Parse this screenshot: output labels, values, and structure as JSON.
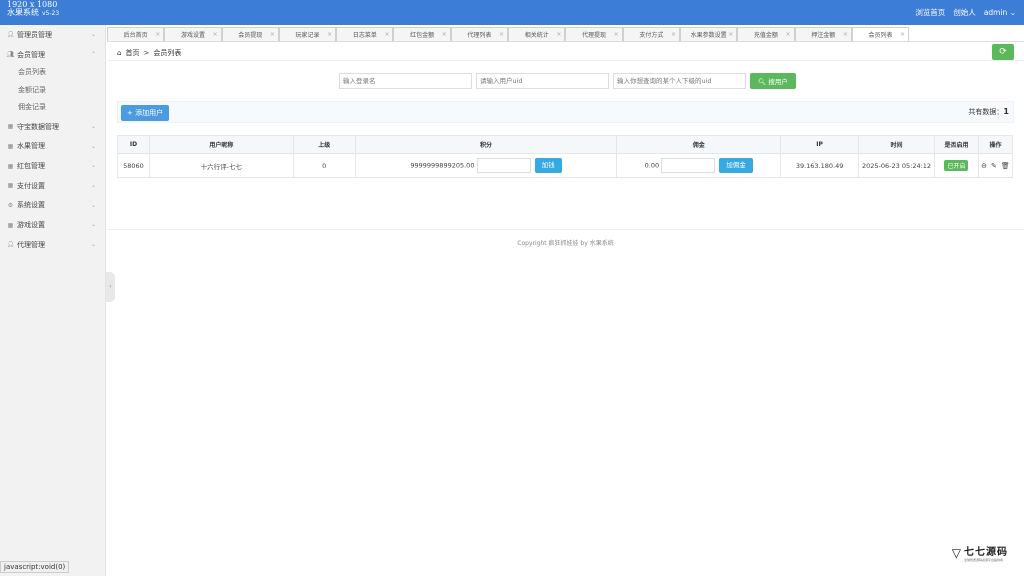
{
  "top": {
    "resolution": "1920 x 1080",
    "brand": "水果系统",
    "version": "v5-23",
    "nav": [
      "浏览首页",
      "创始人",
      "admin"
    ]
  },
  "sidebar": {
    "groups": [
      {
        "label": "管理员管理",
        "icon": "user-icon"
      },
      {
        "label": "会员管理",
        "icon": "users-icon",
        "expanded": true,
        "items": [
          "会员列表",
          "金额记录",
          "佣金记录"
        ]
      },
      {
        "label": "守宝数据管理",
        "icon": "grid-icon"
      },
      {
        "label": "水果管理",
        "icon": "grid-icon"
      },
      {
        "label": "红包管理",
        "icon": "grid-icon"
      },
      {
        "label": "支付设置",
        "icon": "grid-icon"
      },
      {
        "label": "系统设置",
        "icon": "gear-icon"
      },
      {
        "label": "游戏设置",
        "icon": "grid-icon"
      },
      {
        "label": "代理管理",
        "icon": "user-icon"
      }
    ]
  },
  "tabs": [
    "后台首页",
    "游戏设置",
    "会员提现",
    "玩家记录",
    "日志菜单",
    "红包金额",
    "代理列表",
    "相关统计",
    "代理提现",
    "支付方式",
    "水果参数设置",
    "充值金额",
    "押注金额",
    "会员列表"
  ],
  "breadcrumb": {
    "home": "首页",
    "current": "会员列表"
  },
  "search": {
    "p1": "输入登录名",
    "p2": "请输入用户uid",
    "p3": "输入你想查询的某个人下级的uid",
    "button": "搜用户"
  },
  "toolbar": {
    "add": "添加用户",
    "total_label": "共有数据：",
    "total": "1"
  },
  "table": {
    "headers": [
      "ID",
      "用户昵称",
      "上级",
      "积分",
      "佣金",
      "IP",
      "时间",
      "是否启用",
      "操作"
    ],
    "row": {
      "id": "58060",
      "nick": "十六行评-七七",
      "parent": "0",
      "points": "9999999899205.00",
      "points_btn": "加钱",
      "commission": "0.00",
      "commission_btn": "加佣金",
      "ip": "39.163.180.49",
      "time": "2025-06-23 05:24:12",
      "status": "已开启"
    }
  },
  "footer": "Copyright 疯狂抓娃娃 by 水果系统",
  "statusbar": "javascript:void(0)",
  "watermark": {
    "name": "七七源码",
    "sub": "全球优质源码资源平台提供商"
  }
}
